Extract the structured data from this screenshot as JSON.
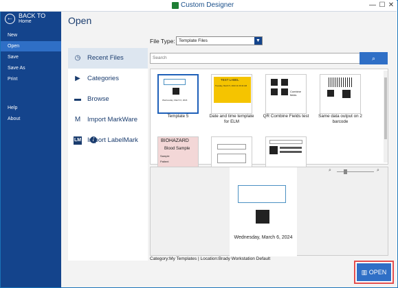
{
  "window": {
    "title": "Custom Designer",
    "min": "—",
    "max": "☐",
    "close": "✕"
  },
  "sidebar": {
    "back_label": "BACK TO",
    "back_sub": "Home",
    "items": [
      "New",
      "Open",
      "Save",
      "Save As",
      "Print",
      "Help",
      "About"
    ]
  },
  "main": {
    "title": "Open"
  },
  "left_panel": {
    "items": [
      "Recent Files",
      "Categories",
      "Browse",
      "Import MarkWare",
      "Import LabelMark"
    ]
  },
  "file_type": {
    "label": "File Type:",
    "value": "Template Files"
  },
  "search": {
    "placeholder": "Search"
  },
  "templates": [
    {
      "caption": "Template 5",
      "selected": true
    },
    {
      "caption": "Date and time template for ELM"
    },
    {
      "caption": "QR Combine Fields test"
    },
    {
      "caption": "Same data output on 2 barcode"
    },
    {
      "caption": "BIOHAZARD"
    },
    {
      "caption": ""
    },
    {
      "caption": ""
    }
  ],
  "thumb_text": {
    "t1_date": "Wednesday, March 6, 2024",
    "t2_title": "TEST LABEL",
    "t2_date": "Tuesday, March 5, 2024 11:30:42 AM",
    "t3_text": "Combine fields",
    "t5_title": "BIOHAZARD",
    "t5_sub": "Blood Sample",
    "t5_f1": "Sample",
    "t5_f2": "Patient"
  },
  "preview": {
    "date": "Wednesday, March 6, 2024"
  },
  "status": {
    "text": "Category:My Templates | Location:Brady Workstation Default"
  },
  "open_button": {
    "label": "OPEN"
  },
  "colors": {
    "sidebar": "#14448c",
    "accent": "#2f6fc6",
    "highlight": "#e24c4c"
  }
}
